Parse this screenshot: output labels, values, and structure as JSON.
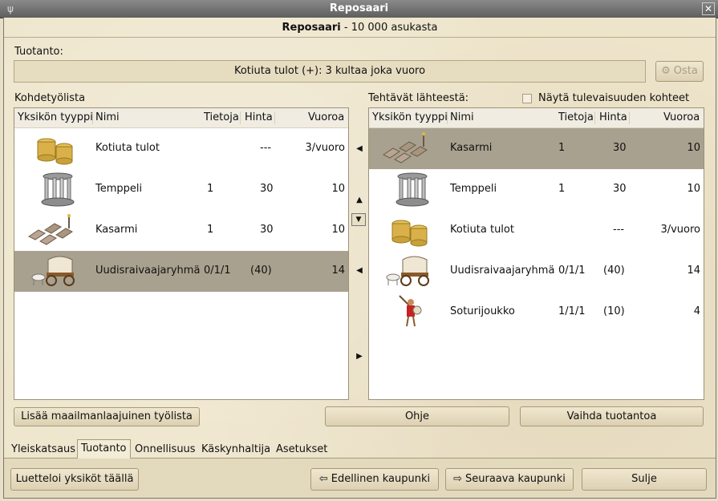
{
  "window": {
    "title": "Reposaari",
    "close_glyph": "✕",
    "icon": "window-menu-icon"
  },
  "heading": {
    "city": "Reposaari",
    "population": "- 10 000 asukasta"
  },
  "production": {
    "label": "Tuotanto:",
    "current": "Kotiuta tulot (+):  3 kultaa joka vuoro",
    "buy_label": "Osta"
  },
  "worklist": {
    "title": "Kohdetyölista",
    "columns": [
      "Yksikön tyyppi",
      "Nimi",
      "Tietoja",
      "Hinta",
      "Vuoroa"
    ],
    "rows": [
      {
        "icon": "gold-coins-icon",
        "name": "Kotiuta tulot",
        "info": "",
        "cost": "---",
        "turns": "3/vuoro",
        "selected": false
      },
      {
        "icon": "temple-icon",
        "name": "Temppeli",
        "info": "1",
        "cost": "30",
        "turns": "10",
        "selected": false
      },
      {
        "icon": "barracks-icon",
        "name": "Kasarmi",
        "info": "1",
        "cost": "30",
        "turns": "10",
        "selected": false
      },
      {
        "icon": "settlers-wagon-icon",
        "name": "Uudisraivaajaryhmä",
        "info": "0/1/1",
        "cost": "(40)",
        "turns": "14",
        "selected": true
      }
    ]
  },
  "source": {
    "title": "Tehtävät lähteestä:",
    "future_label": "Näytä tulevaisuuden kohteet",
    "columns": [
      "Yksikön tyyppi",
      "Nimi",
      "Tietoja",
      "Hinta",
      "Vuoroa"
    ],
    "rows": [
      {
        "icon": "barracks-icon",
        "name": "Kasarmi",
        "info": "1",
        "cost": "30",
        "turns": "10",
        "selected": true
      },
      {
        "icon": "temple-icon",
        "name": "Temppeli",
        "info": "1",
        "cost": "30",
        "turns": "10",
        "selected": false
      },
      {
        "icon": "gold-coins-icon",
        "name": "Kotiuta tulot",
        "info": "",
        "cost": "---",
        "turns": "3/vuoro",
        "selected": false
      },
      {
        "icon": "settlers-wagon-icon",
        "name": "Uudisraivaajaryhmä",
        "info": "0/1/1",
        "cost": "(40)",
        "turns": "14",
        "selected": false
      },
      {
        "icon": "warriors-icon",
        "name": "Soturijoukko",
        "info": "1/1/1",
        "cost": "(10)",
        "turns": "4",
        "selected": false
      }
    ]
  },
  "actions": {
    "add_worklist": "Lisää maailmanlaajuinen työlista",
    "help": "Ohje",
    "change_production": "Vaihda tuotantoa"
  },
  "tabs": [
    "Yleiskatsaus",
    "Tuotanto",
    "Onnellisuus",
    "Käskynhaltija",
    "Asetukset"
  ],
  "active_tab": "Tuotanto",
  "footer": {
    "list_units": "Luetteloi yksiköt täällä",
    "prev_city": "Edellinen kaupunki",
    "next_city": "Seuraava kaupunki",
    "close": "Sulje"
  }
}
